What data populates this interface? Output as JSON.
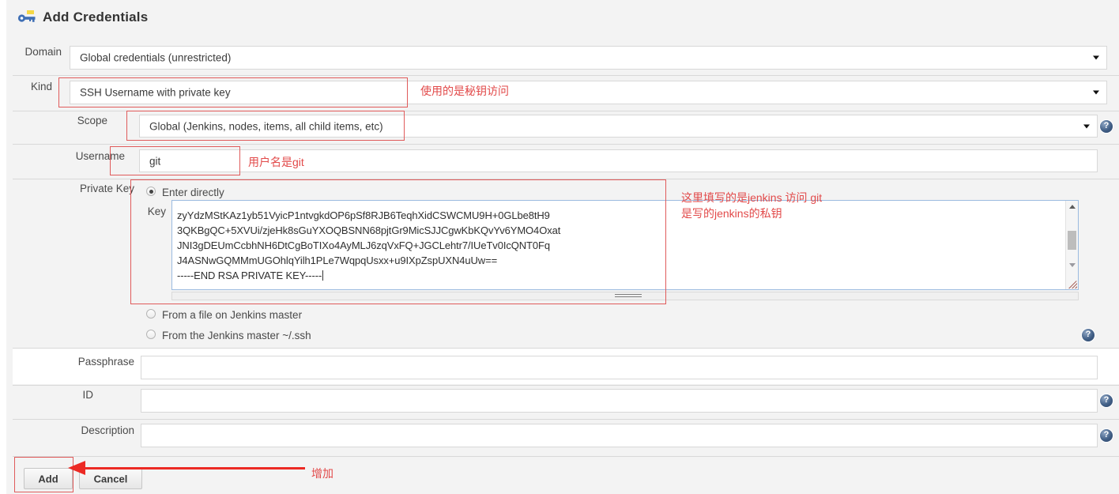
{
  "page": {
    "title": "Add Credentials",
    "title_icon": "key-icon"
  },
  "form": {
    "domain": {
      "label": "Domain",
      "value": "Global credentials (unrestricted)"
    },
    "kind": {
      "label": "Kind",
      "value": "SSH Username with private key"
    },
    "scope": {
      "label": "Scope",
      "value": "Global (Jenkins, nodes, items, all child items, etc)"
    },
    "username": {
      "label": "Username",
      "value": "git"
    },
    "private_key": {
      "label": "Private Key",
      "options": [
        "Enter directly",
        "From a file on Jenkins master",
        "From the Jenkins master ~/.ssh"
      ],
      "selected_option": "Enter directly",
      "key_label": "Key",
      "key_lines": [
        "zyYdzMStKAz1yb51VyicP1ntvgkdOP6pSf8RJB6TeqhXidCSWCMU9H+0GLbe8tH9",
        "3QKBgQC+5XVUi/zjeHk8sGuYXOQBSNN68pjtGr9MicSJJCgwKbKQvYv6YMO4Oxat",
        "JNI3gDEUmCcbhNH6DtCgBoTIXo4AyMLJ6zqVxFQ+JGCLehtr7/IUeTv0IcQNT0Fq",
        "J4ASNwGQMMmUGOhlqYilh1PLe7WqpqUsxx+u9IXpZspUXN4uUw==",
        "-----END RSA PRIVATE KEY-----"
      ]
    },
    "passphrase": {
      "label": "Passphrase",
      "value": ""
    },
    "id": {
      "label": "ID",
      "value": ""
    },
    "description": {
      "label": "Description",
      "value": ""
    }
  },
  "buttons": {
    "add": "Add",
    "cancel": "Cancel"
  },
  "annotations": {
    "kind_note": "使用的是秘钥访问",
    "username_note": "用户名是git",
    "key_note_line1": "这里填写的是jenkins 访问 git",
    "key_note_line2": "是写的jenkins的私钥",
    "add_note": "增加"
  },
  "colors": {
    "annotation_red": "#e24a4a",
    "box_red": "#e05b5b",
    "arrow_red": "#ec2a24",
    "help_blue": "#415f86",
    "page_bg": "#f3f3f3"
  }
}
